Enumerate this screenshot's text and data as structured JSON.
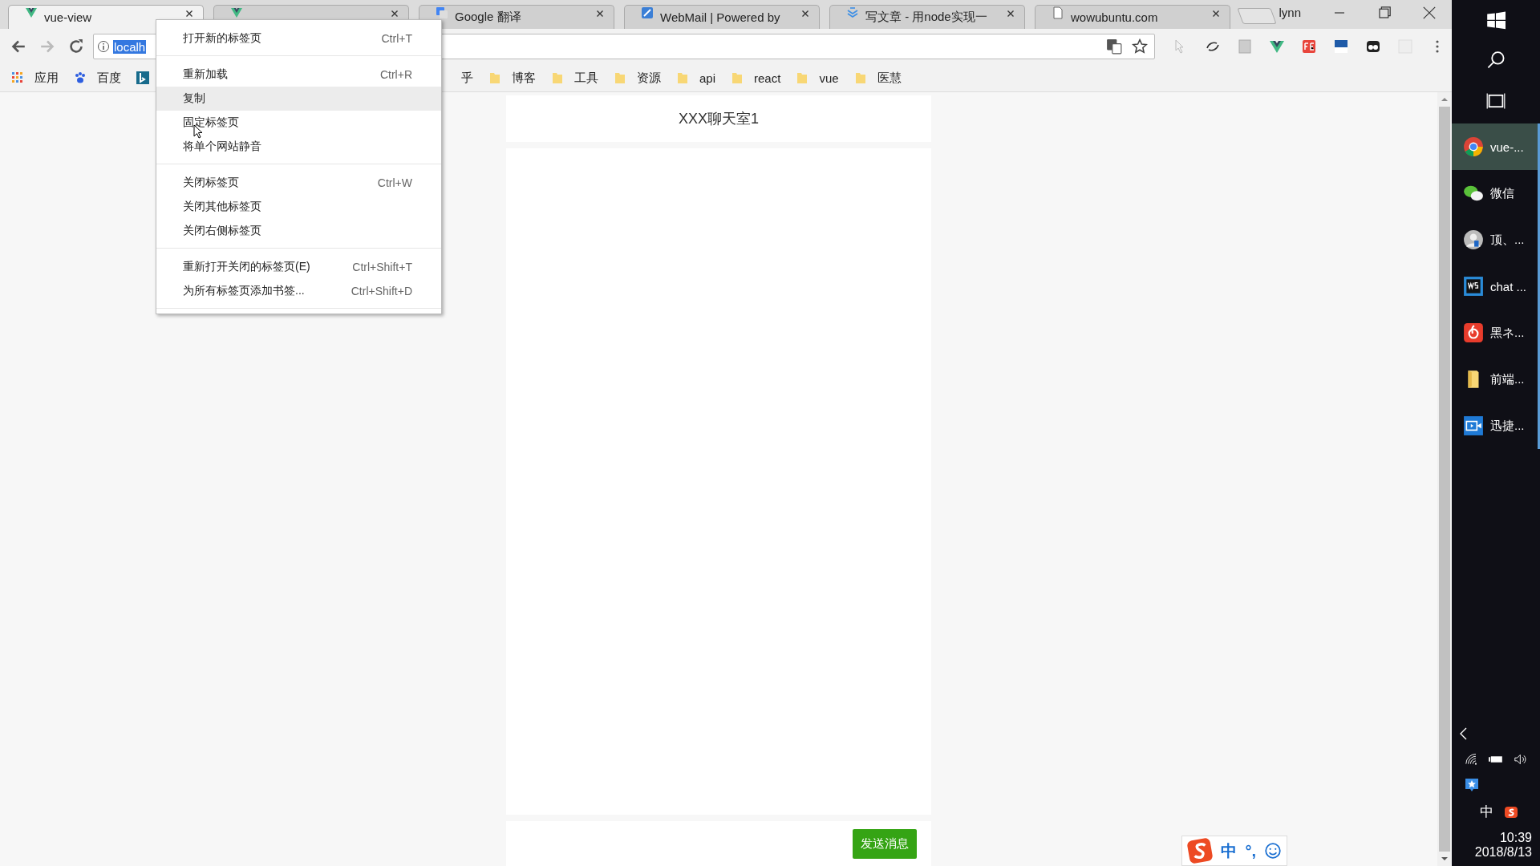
{
  "browser": {
    "tabs": [
      {
        "kind": "vue",
        "title": "vue-view",
        "selected": true
      },
      {
        "kind": "vue",
        "selected": false
      },
      {
        "kind": "translate",
        "title": "Google 翻译",
        "selected": false
      },
      {
        "kind": "mail",
        "title": "WebMail | Powered by",
        "selected": false
      },
      {
        "kind": "write",
        "title": "写文章 - 用node实现一",
        "selected": false
      },
      {
        "kind": "page",
        "title": "wowubuntu.com",
        "selected": false
      }
    ],
    "user": "lynn",
    "address": {
      "value": "localh"
    },
    "bookmarks": [
      {
        "kind": "apps",
        "label": "应用"
      },
      {
        "kind": "paw",
        "label": "百度"
      },
      {
        "kind": "bing"
      },
      {
        "kind": "text",
        "label": "乎"
      },
      {
        "kind": "folder",
        "label": "博客"
      },
      {
        "kind": "folder",
        "label": "工具"
      },
      {
        "kind": "folder",
        "label": "资源"
      },
      {
        "kind": "folder",
        "label": "api"
      },
      {
        "kind": "folder",
        "label": "react"
      },
      {
        "kind": "folder",
        "label": "vue"
      },
      {
        "kind": "folder",
        "label": "医慧"
      }
    ]
  },
  "context_menu": [
    [
      {
        "label": "打开新的标签页",
        "shortcut": "Ctrl+T",
        "selected": false
      }
    ],
    [
      {
        "label": "重新加载",
        "shortcut": "Ctrl+R",
        "selected": false
      },
      {
        "label": "复制",
        "selected": true
      },
      {
        "label": "固定标签页",
        "selected": false
      },
      {
        "label": "将单个网站静音",
        "selected": false
      }
    ],
    [
      {
        "label": "关闭标签页",
        "shortcut": "Ctrl+W",
        "selected": false
      },
      {
        "label": "关闭其他标签页",
        "selected": false
      },
      {
        "label": "关闭右侧标签页",
        "selected": false
      }
    ],
    [
      {
        "label": "重新打开关闭的标签页(E)",
        "shortcut": "Ctrl+Shift+T",
        "selected": false
      },
      {
        "label": "为所有标签页添加书签...",
        "shortcut": "Ctrl+Shift+D",
        "selected": false
      }
    ]
  ],
  "chat": {
    "title": "XXX聊天室1",
    "send_button": "发送消息"
  },
  "taskbar": {
    "apps": [
      {
        "kind": "chrome",
        "label": "vue-...",
        "selected": true
      },
      {
        "kind": "wechat",
        "label": "微信",
        "selected": false
      },
      {
        "kind": "avatar",
        "label": "顶、...",
        "selected": false
      },
      {
        "kind": "ws",
        "label": "chat ...",
        "selected": false
      },
      {
        "kind": "music",
        "label": "黑ネ...",
        "selected": false
      },
      {
        "kind": "folder",
        "label": "前端...",
        "selected": false
      },
      {
        "kind": "video",
        "label": "迅捷...",
        "selected": false
      }
    ],
    "ime": "中",
    "time": "10:39",
    "date": "2018/8/13"
  },
  "ime_bar": {
    "mode": "中",
    "punct": "°,"
  }
}
